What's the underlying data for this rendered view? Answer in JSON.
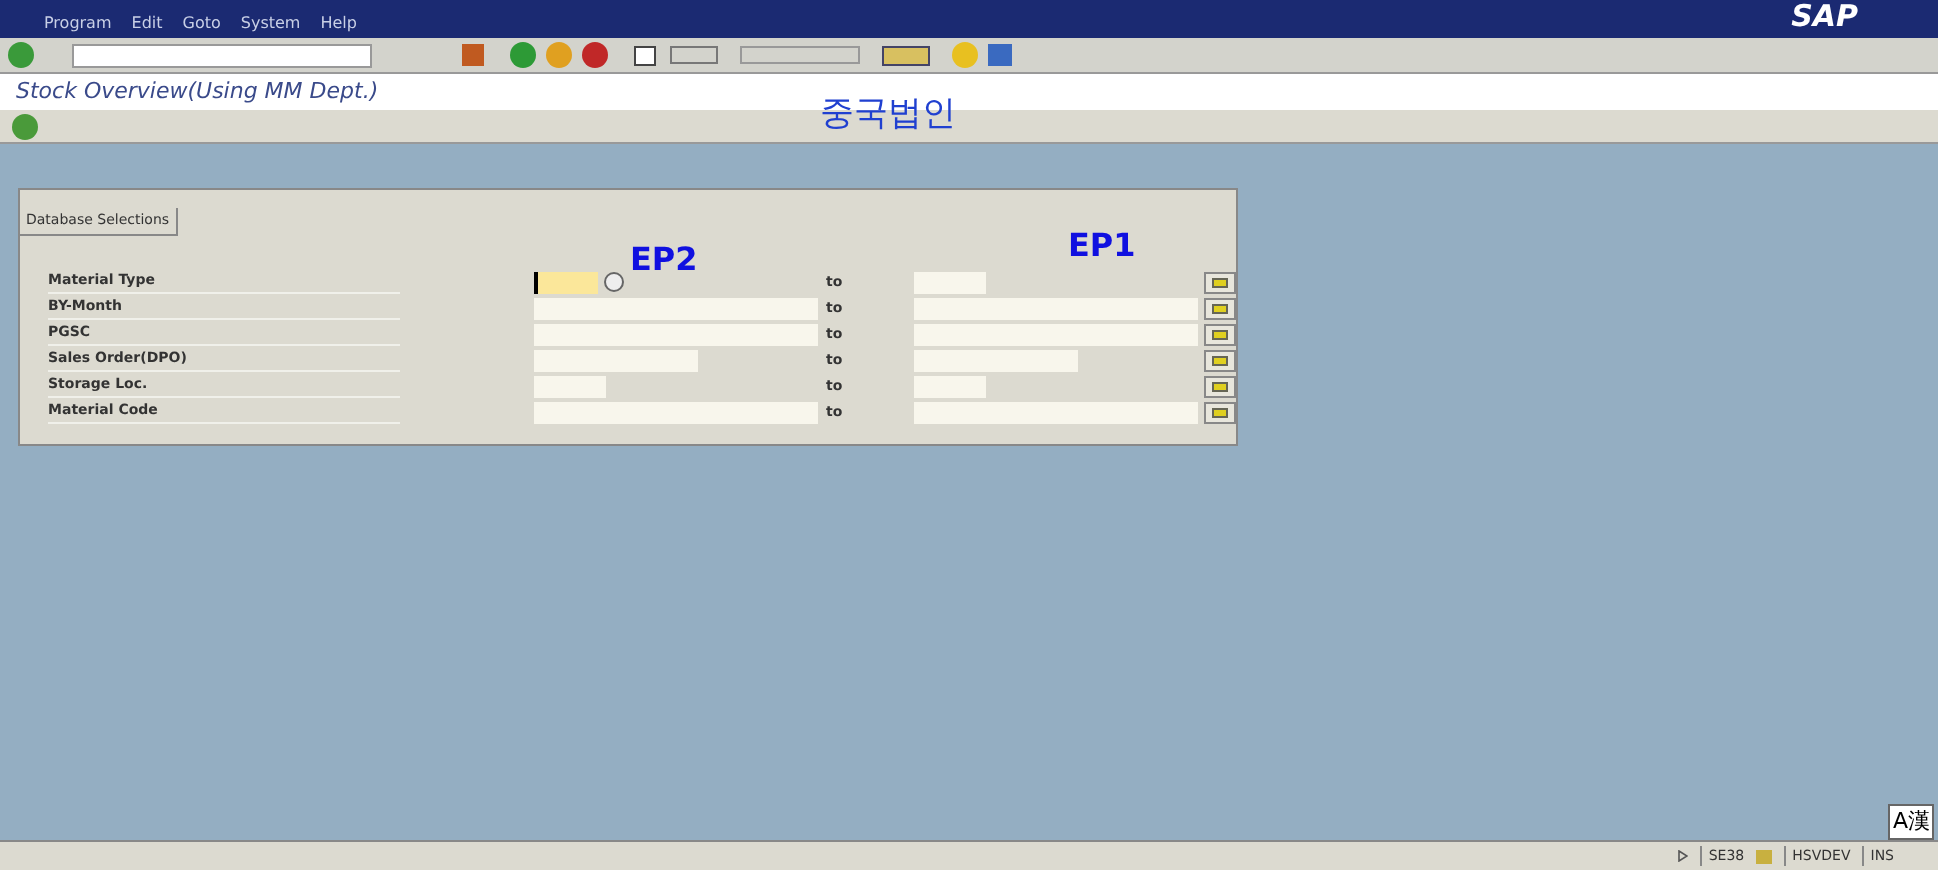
{
  "menu_bar": [
    "Program",
    "Edit",
    "Goto",
    "System",
    "Help"
  ],
  "title": "Stock Overview(Using MM Dept.)",
  "annotation": "중국법인",
  "section": {
    "title": "Database Selections",
    "rows": [
      {
        "label": "Material Type",
        "to": "to",
        "focused": true,
        "help": true
      },
      {
        "label": "BY-Month",
        "to": "to",
        "focused": false,
        "help": false
      },
      {
        "label": "PGSC",
        "to": "to",
        "focused": false,
        "help": false
      },
      {
        "label": "Sales Order(DPO)",
        "to": "to",
        "focused": false,
        "help": false
      },
      {
        "label": "Storage Loc.",
        "to": "to",
        "focused": false,
        "help": false
      },
      {
        "label": "Material Code",
        "to": "to",
        "focused": false,
        "help": false
      }
    ]
  },
  "overlay_labels": [
    "EP2",
    "EP1"
  ],
  "status_bar": {
    "transaction": "SE38",
    "system": "HSVDEV",
    "mode": "INS"
  },
  "ime_indicator": "A漢",
  "logo": "SAP"
}
